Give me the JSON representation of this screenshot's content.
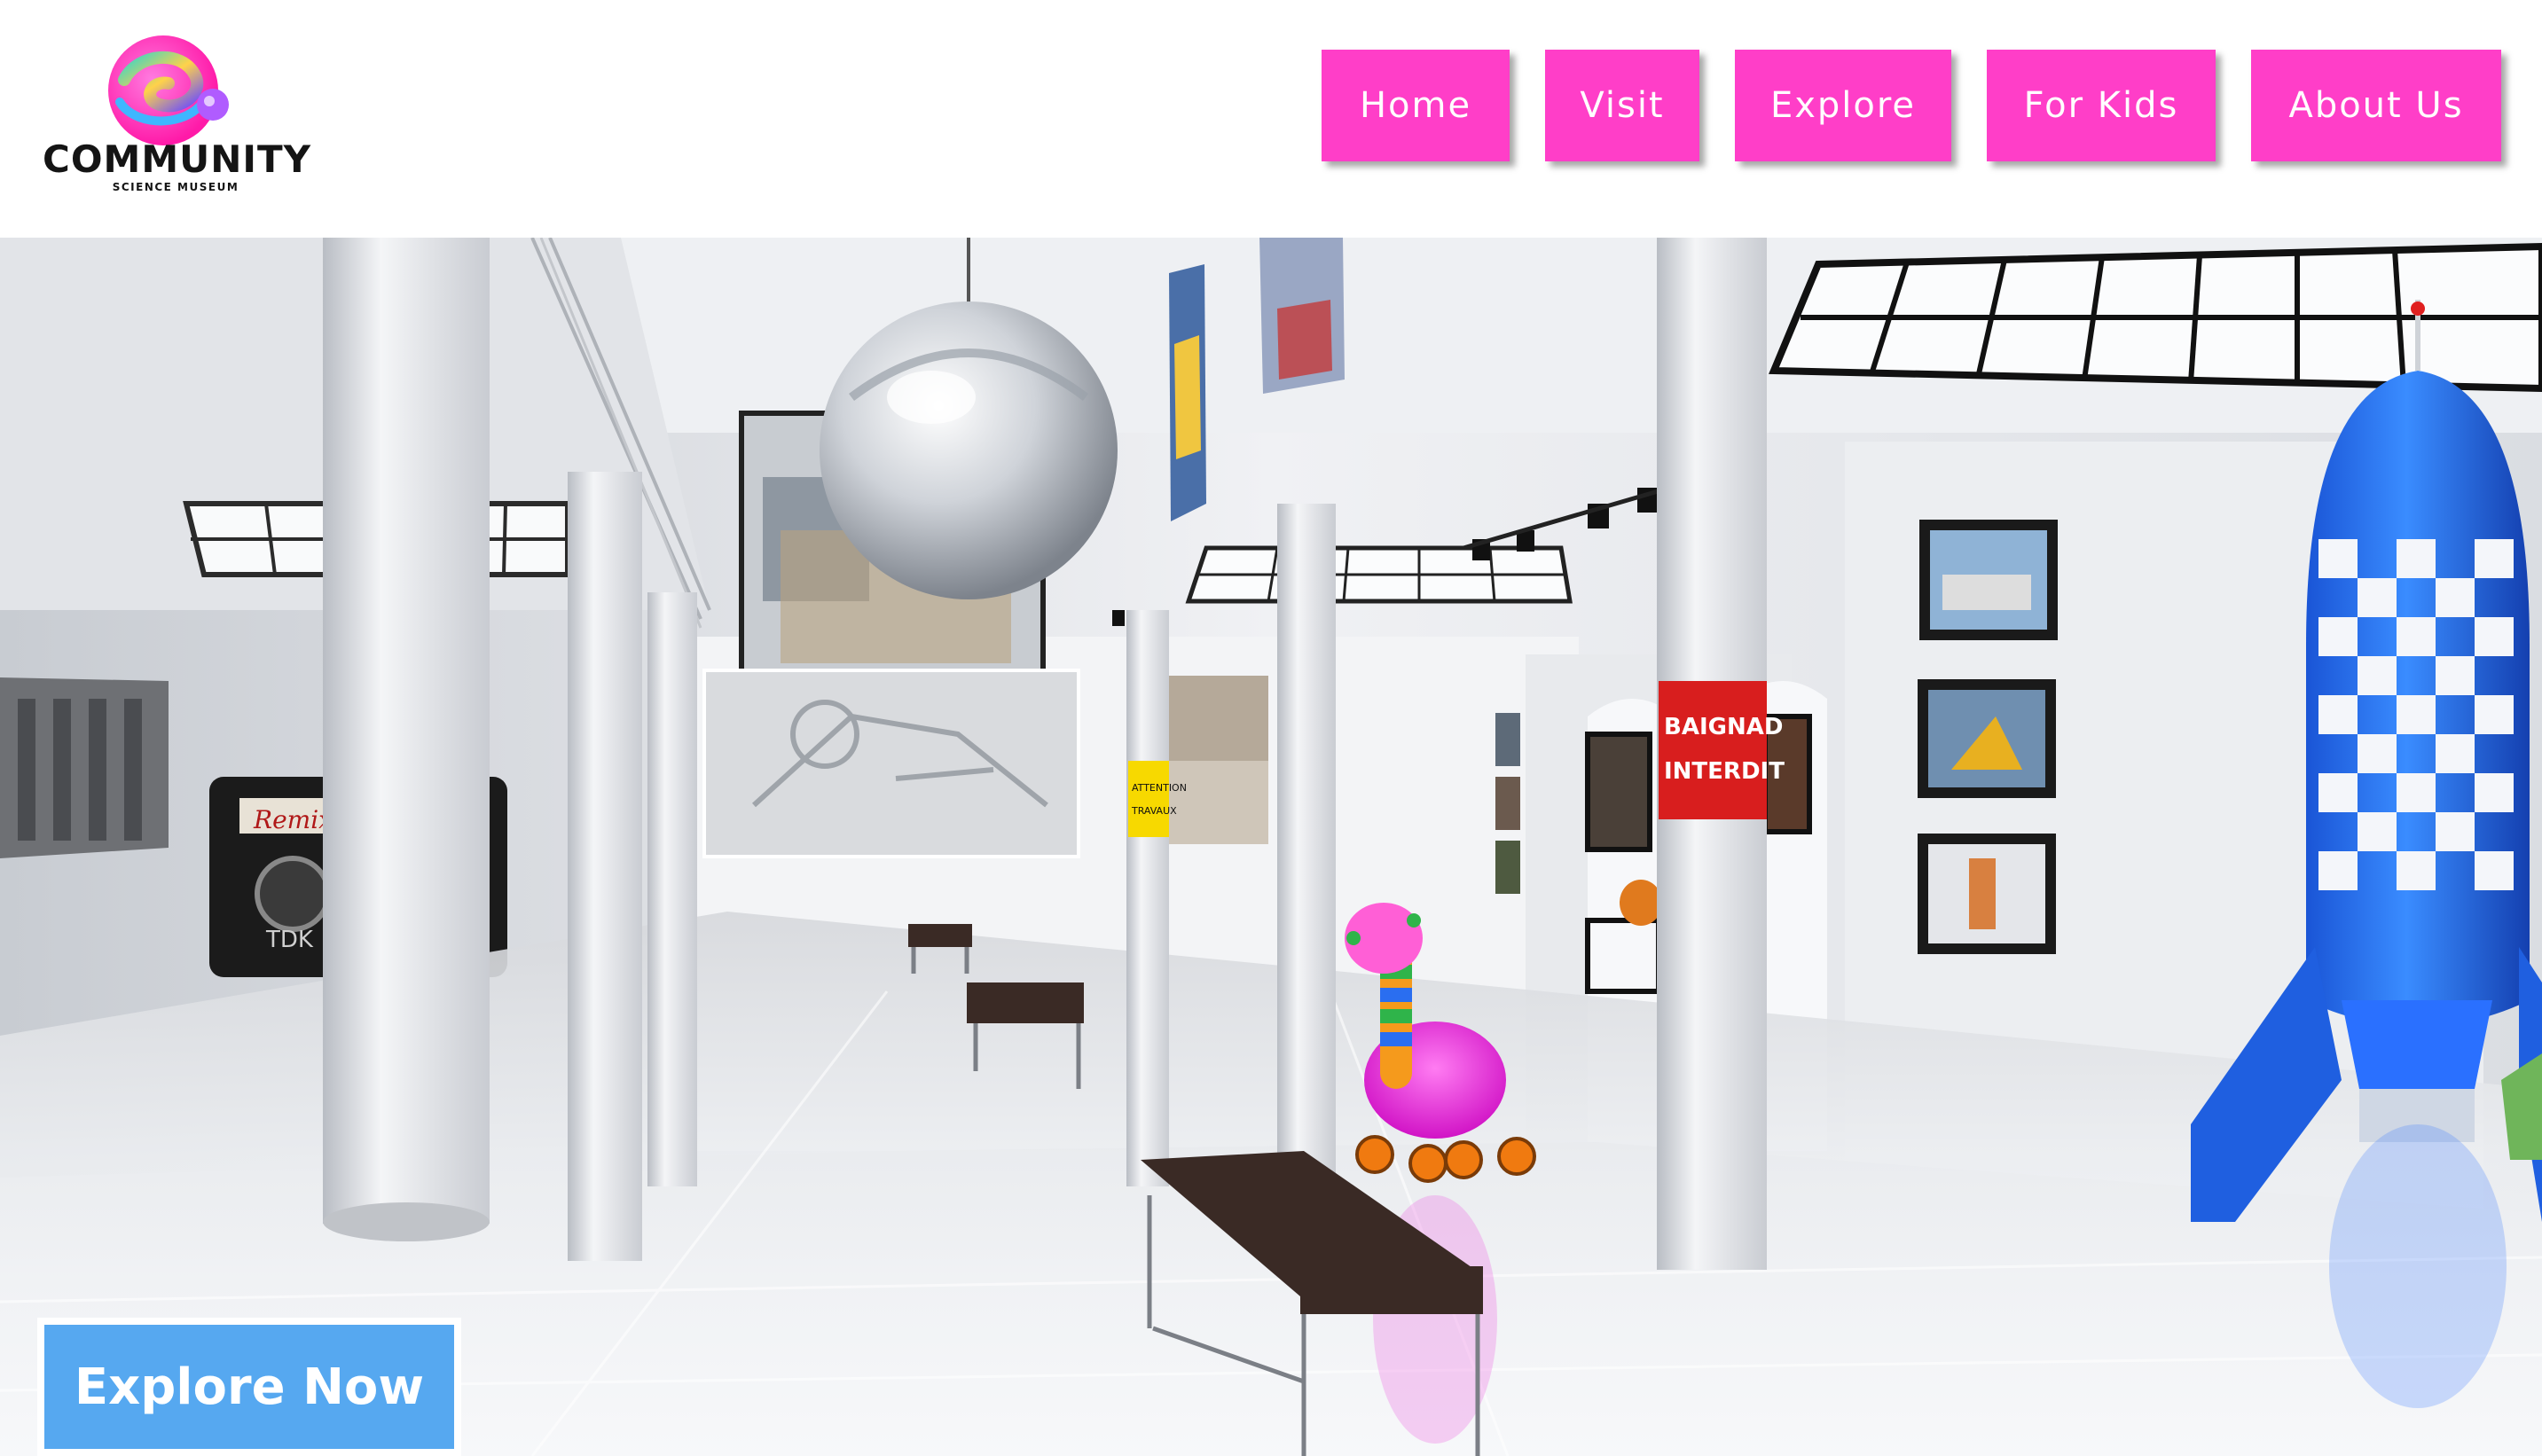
{
  "brand": {
    "name": "COMMUNITY",
    "tagline": "SCIENCE MUSEUM",
    "logo_icon": "swirl-planet-icon",
    "accent_color": "#ff3ec8"
  },
  "nav": {
    "items": [
      {
        "label": "Home"
      },
      {
        "label": "Visit"
      },
      {
        "label": "Explore"
      },
      {
        "label": "For Kids"
      },
      {
        "label": "About Us"
      }
    ],
    "button_color": "#ff3ec8",
    "text_color": "#ffffff"
  },
  "hero": {
    "image_subject": "virtual gallery hall",
    "signs": {
      "tape_text": "Remix",
      "tape_brand": "TDK",
      "pillar_sign": [
        "BAIGNAD",
        "INTERDIT"
      ],
      "caution_sign": [
        "ATTENTION",
        "TRAVAUX"
      ]
    },
    "cta": {
      "label": "Explore Now",
      "color": "#56a8f0"
    }
  }
}
